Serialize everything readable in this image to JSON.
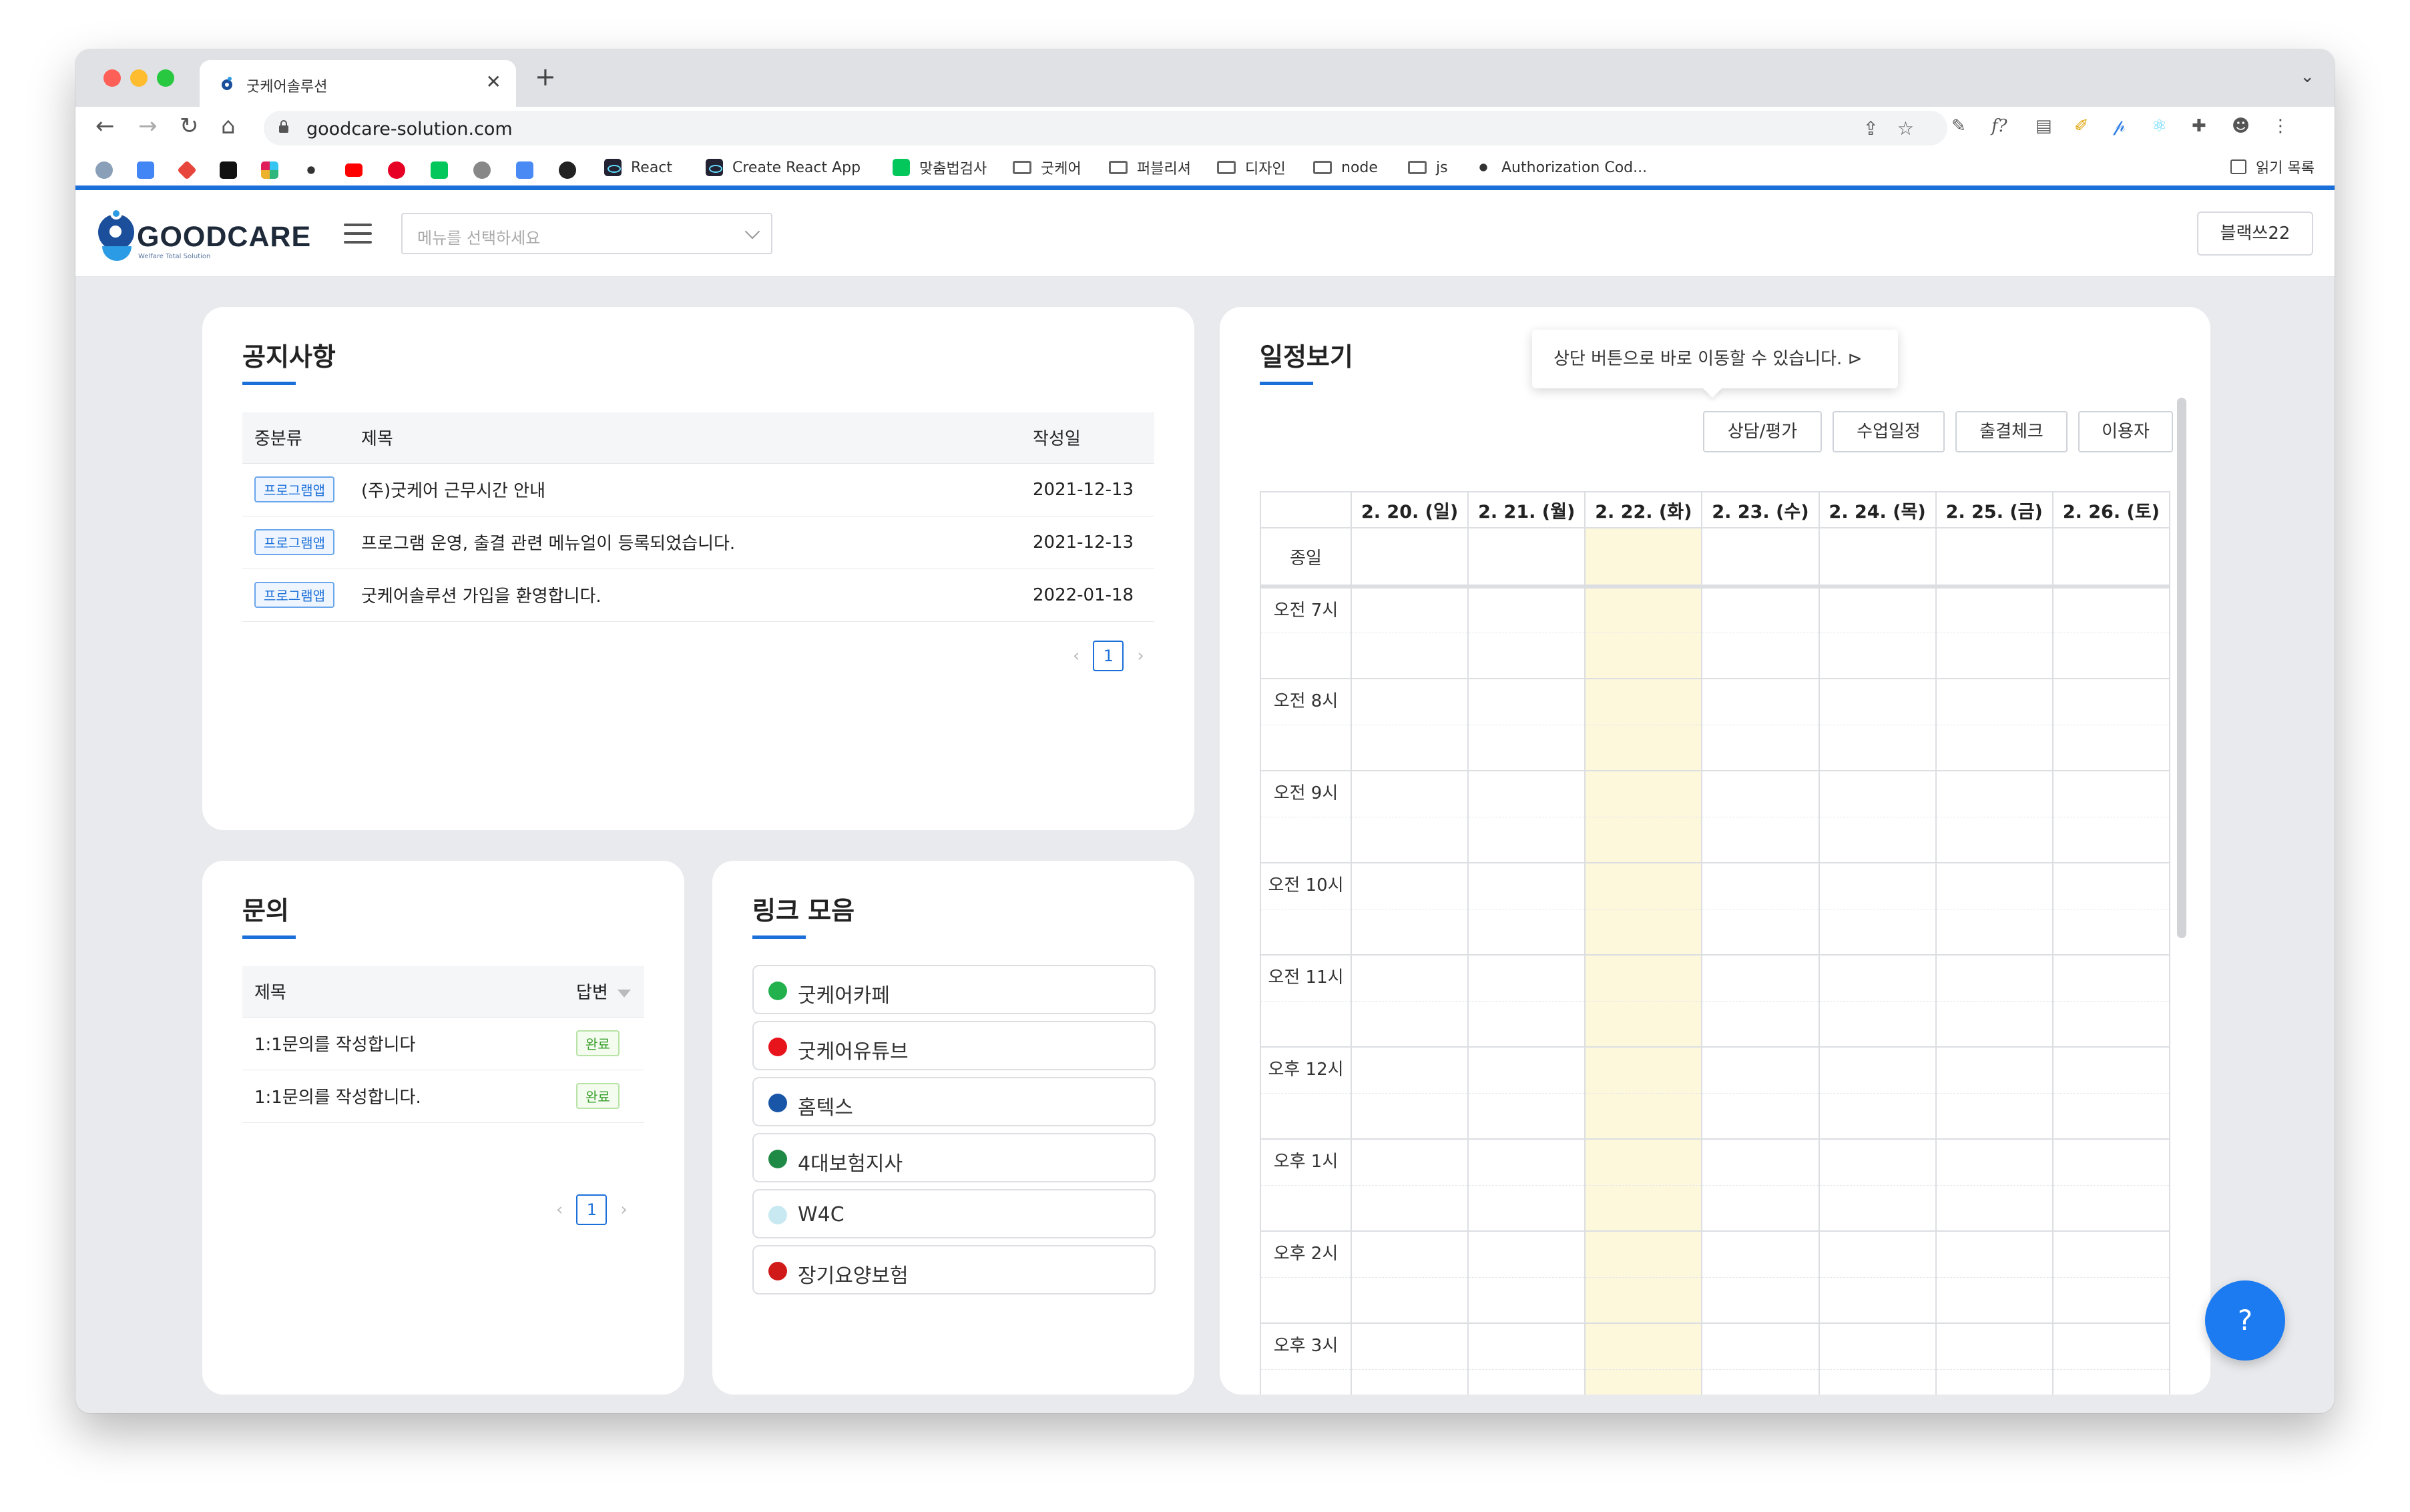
{
  "browser": {
    "tab_title": "굿케어솔루션",
    "tab_close": "✕",
    "new_tab": "+",
    "tab_menu": "⌄",
    "url": "goodcare-solution.com",
    "bookmarks": [
      {
        "label": "React",
        "icon": "react-icon"
      },
      {
        "label": "Create React App",
        "icon": "react-icon"
      },
      {
        "label": "맞춤법검사",
        "icon": "naver-icon"
      },
      {
        "label": "굿케어",
        "icon": "folder-icon"
      },
      {
        "label": "퍼블리셔",
        "icon": "folder-icon"
      },
      {
        "label": "디자인",
        "icon": "folder-icon"
      },
      {
        "label": "node",
        "icon": "folder-icon"
      },
      {
        "label": "js",
        "icon": "folder-icon"
      },
      {
        "label": "Authorization Cod...",
        "icon": "dots-icon"
      }
    ],
    "reading_list": "읽기 목록"
  },
  "header": {
    "logo_text": "GOODCARE",
    "logo_sub": "Welfare Total Solution",
    "menu_placeholder": "메뉴를 선택하세요",
    "user": "블랙쓰22"
  },
  "notice": {
    "title": "공지사항",
    "columns": [
      "중분류",
      "제목",
      "작성일"
    ],
    "rows": [
      {
        "category": "프로그램앱",
        "title": "(주)굿케어 근무시간 안내",
        "date": "2021-12-13"
      },
      {
        "category": "프로그램앱",
        "title": "프로그램 운영, 출결 관련 메뉴얼이 등록되었습니다.",
        "date": "2021-12-13"
      },
      {
        "category": "프로그램앱",
        "title": "굿케어솔루션 가입을 환영합니다.",
        "date": "2022-01-18"
      }
    ],
    "page": "1"
  },
  "inquiry": {
    "title": "문의",
    "columns": [
      "제목",
      "답변"
    ],
    "rows": [
      {
        "title": "1:1문의를 작성합니다",
        "status": "완료"
      },
      {
        "title": "1:1문의를 작성합니다.",
        "status": "완료"
      }
    ],
    "page": "1"
  },
  "links": {
    "title": "링크 모음",
    "items": [
      {
        "label": "굿케어카페",
        "color": "#22b14c"
      },
      {
        "label": "굿케어유튜브",
        "color": "#e8141b"
      },
      {
        "label": "홈텍스",
        "color": "#1a56a8"
      },
      {
        "label": "4대보험지사",
        "color": "#1f8a45"
      },
      {
        "label": "W4C",
        "color": "#c9e9f2"
      },
      {
        "label": "장기요양보험",
        "color": "#d01a1a"
      }
    ]
  },
  "schedule": {
    "title": "일정보기",
    "tooltip": "상단 버튼으로 바로 이동할 수 있습니다.",
    "buttons": [
      "상담/평가",
      "수업일정",
      "출결체크",
      "이용자"
    ],
    "days": [
      "2. 20. (일)",
      "2. 21. (월)",
      "2. 22. (화)",
      "2. 23. (수)",
      "2. 24. (목)",
      "2. 25. (금)",
      "2. 26. (토)"
    ],
    "highlight_index": 2,
    "highlight_color": "#fdf7dc",
    "all_day": "종일",
    "hours": [
      "오전 7시",
      "오전 8시",
      "오전 9시",
      "오전 10시",
      "오전 11시",
      "오후 12시",
      "오후 1시",
      "오후 2시",
      "오후 3시"
    ]
  },
  "help": "?",
  "colors": {
    "accent": "#1b6fd9",
    "done_green": "#3aa02b"
  }
}
